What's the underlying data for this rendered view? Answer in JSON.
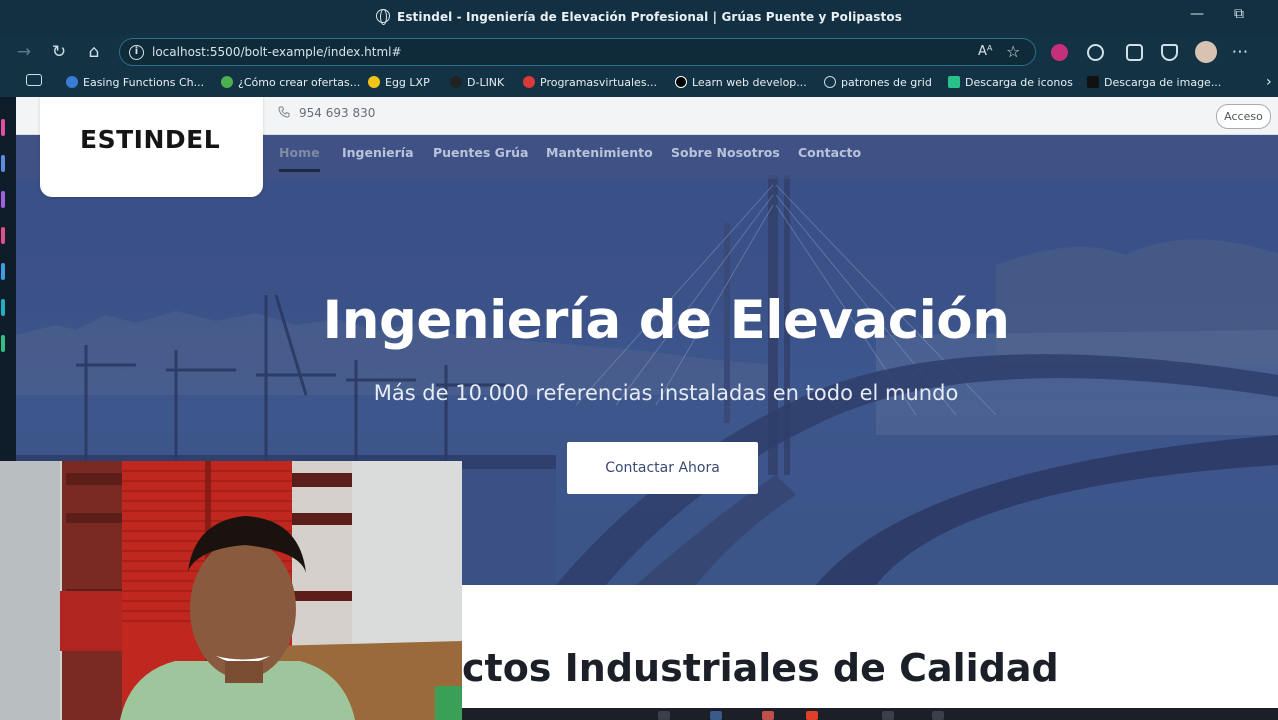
{
  "browser": {
    "window_title": "Estindel - Ingeniería de Elevación Profesional | Grúas Puente y Polipastos",
    "url": "localhost:5500/bolt-example/index.html#",
    "reader_label": "Aᴬ",
    "window_controls": {
      "minimize": "—",
      "maximize": "⧉"
    },
    "bookmarks": [
      {
        "label": "Easing Functions Ch...",
        "icon": "easing-icon",
        "color": "#3a7bd5"
      },
      {
        "label": "¿Cómo crear ofertas...",
        "icon": "graph-icon",
        "color": "#4caf50"
      },
      {
        "label": "Egg LXP",
        "icon": "egg-icon",
        "color": "#f2c318"
      },
      {
        "label": "D-LINK",
        "icon": "dlink-icon",
        "color": "#222222"
      },
      {
        "label": "Programasvirtuales...",
        "icon": "p-icon",
        "color": "#d93a3a"
      },
      {
        "label": "Learn web develop...",
        "icon": "mdn-icon",
        "color": "#000000"
      },
      {
        "label": "patrones de grid",
        "icon": "globe-icon",
        "color": "#c9d6de"
      },
      {
        "label": "Descarga de iconos",
        "icon": "vector-icon",
        "color": "#29c08a"
      },
      {
        "label": "Descarga de image...",
        "icon": "unsplash-icon",
        "color": "#111111"
      }
    ]
  },
  "site": {
    "phone": "954 693 830",
    "access_label": "Acceso",
    "logo_text": "ESTINDEL",
    "nav": [
      {
        "label": "Home",
        "active": true
      },
      {
        "label": "Ingeniería",
        "active": false
      },
      {
        "label": "Puentes Grúa",
        "active": false
      },
      {
        "label": "Mantenimiento",
        "active": false
      },
      {
        "label": "Sobre Nosotros",
        "active": false
      },
      {
        "label": "Contacto",
        "active": false
      }
    ],
    "hero": {
      "title": "Ingeniería de Elevación",
      "subtitle": "Más de 10.000 referencias instaladas en todo el mundo",
      "cta_label": "Contactar Ahora"
    },
    "section_title_visible": "ctos Industriales de Calidad"
  },
  "colors": {
    "hero_overlay": "#3b5188",
    "browser_bar": "#133344",
    "omnibox_border": "#2a6f92",
    "cta_text": "#3a4a73"
  }
}
